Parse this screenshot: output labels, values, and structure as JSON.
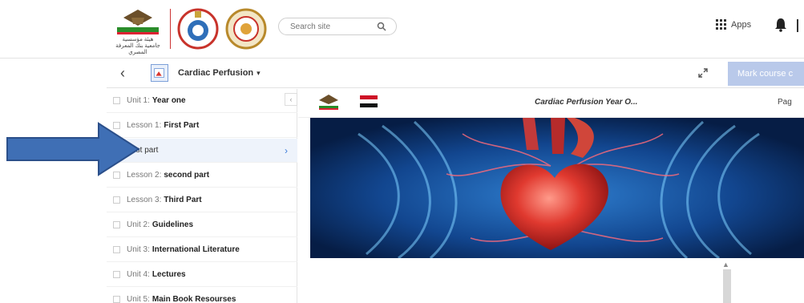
{
  "header": {
    "logo_text": "هيئة مؤسسية جامعية بنك المعرفة المصري",
    "search": {
      "placeholder": "Search site"
    },
    "apps_label": "Apps"
  },
  "course_bar": {
    "back_label": "‹",
    "title": "Cardiac Perfusion",
    "caret": "▾",
    "mark_button_label": "Mark course c"
  },
  "sidebar": {
    "items": [
      {
        "prefix": "Unit 1:",
        "name": "Year one"
      },
      {
        "prefix": "Lesson 1:",
        "name": "First Part"
      },
      {
        "prefix": "",
        "name": "First part"
      },
      {
        "prefix": "Lesson 2:",
        "name": "second part"
      },
      {
        "prefix": "Lesson 3:",
        "name": "Third Part"
      },
      {
        "prefix": "Unit 2:",
        "name": "Guidelines"
      },
      {
        "prefix": "Unit 3:",
        "name": "International Literature"
      },
      {
        "prefix": "Unit 4:",
        "name": "Lectures"
      },
      {
        "prefix": "Unit 5:",
        "name": "Main Book Resourses"
      }
    ],
    "chevron": "›",
    "collapse": "‹"
  },
  "viewer": {
    "title": "Cardiac Perfusion Year O...",
    "page_label": "Pag"
  },
  "colors": {
    "accent": "#3d7bd9",
    "mark_button": "#b9c9ea",
    "arrow": "#3f6fb5",
    "heart": "#d9372f"
  }
}
